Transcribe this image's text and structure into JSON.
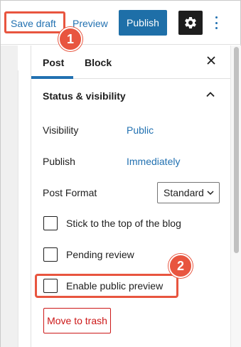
{
  "toolbar": {
    "save_draft": "Save draft",
    "preview": "Preview",
    "publish": "Publish",
    "settings_icon": "gear-icon",
    "more_icon": "kebab-menu-icon"
  },
  "sidebar": {
    "tabs": [
      {
        "label": "Post",
        "active": true
      },
      {
        "label": "Block",
        "active": false
      }
    ],
    "close_icon": "close-icon",
    "section": {
      "title": "Status & visibility",
      "expanded": true,
      "rows": [
        {
          "label": "Visibility",
          "value": "Public"
        },
        {
          "label": "Publish",
          "value": "Immediately"
        }
      ],
      "post_format": {
        "label": "Post Format",
        "selected": "Standard"
      },
      "checkboxes": [
        {
          "label": "Stick to the top of the blog",
          "checked": false
        },
        {
          "label": "Pending review",
          "checked": false
        },
        {
          "label": "Enable public preview",
          "checked": false
        }
      ],
      "trash_button": "Move to trash"
    }
  },
  "annotations": [
    {
      "number": "1",
      "target": "Save draft"
    },
    {
      "number": "2",
      "target": "Enable public preview"
    }
  ],
  "colors": {
    "accent": "#2271b1",
    "publish_bg": "#1e6fa8",
    "danger": "#cc1818",
    "annotation": "#e8553f"
  }
}
